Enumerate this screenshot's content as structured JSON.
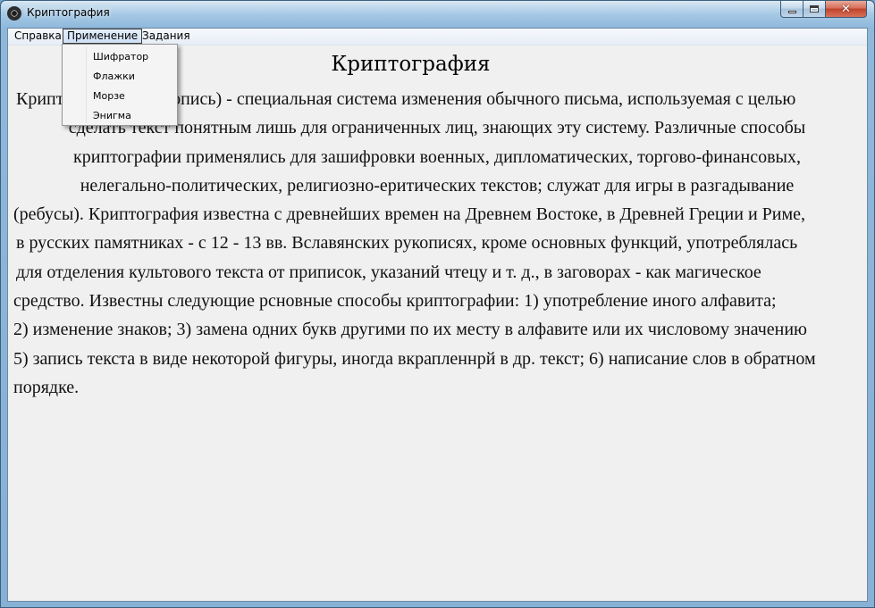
{
  "window": {
    "title": "Криптография"
  },
  "menubar": {
    "items": [
      {
        "label": "Справка"
      },
      {
        "label": "Применение"
      },
      {
        "label": "Задания"
      }
    ]
  },
  "dropdown": {
    "items": [
      {
        "label": "Шифратор"
      },
      {
        "label": "Флажки"
      },
      {
        "label": "Морзе"
      },
      {
        "label": "Энигма"
      }
    ]
  },
  "content": {
    "heading": "Криптография",
    "lines": [
      "Криптография (тайнопись) -  специальная система изменения обычного письма, используемая с целью",
      "сделать текст понятным лишь для ограниченных лиц, знающих эту систему. Различные способы",
      "криптографии применялись для зашифровки военных, дипломатических, торгово-финансовых,",
      "нелегально-политических, религиозно-еритических текстов; служат для игры в разгадывание",
      "(ребусы). Криптография известна с древнейших времен на Древнем Востоке, в Древней Греции и Риме,",
      "в русских памятниках - с 12 - 13 вв. Вславянских рукописях, кроме основных функций, употреблялась",
      "для отделения культового текста от приписок, указаний чтецу и т. д., в заговорах - как магическое",
      "средство. Известны следующие рсновные способы криптографии: 1) употребление иного алфавита;",
      "2) изменение знаков; 3) замена одних букв другими по их месту в алфавите или их числовому значению",
      "5) запись текста в виде некоторой фигуры, иногда вкрапленнрй в др. текст; 6) написание слов в обратном",
      "порядке."
    ]
  }
}
